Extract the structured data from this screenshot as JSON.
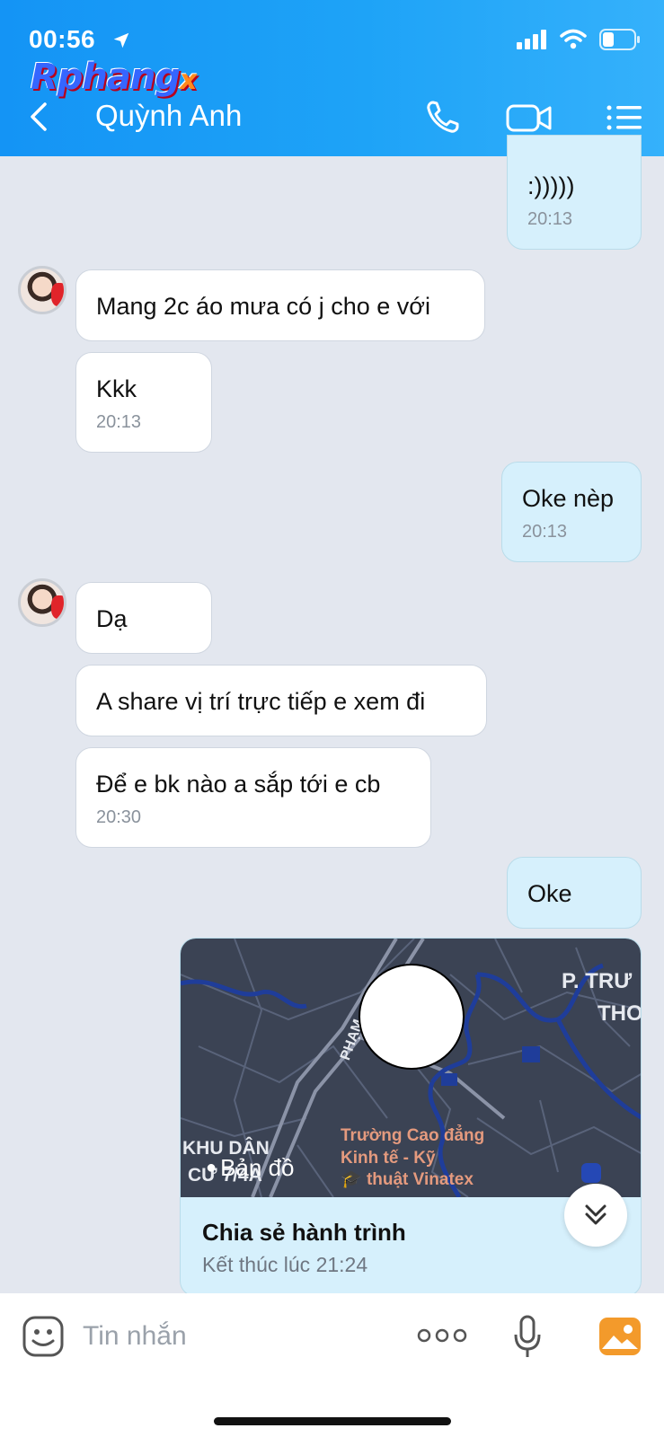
{
  "status_bar": {
    "time": "00:56"
  },
  "watermark": {
    "main": "Rphang",
    "suffix": "x"
  },
  "header": {
    "contact_name": "Quỳnh Anh"
  },
  "messages": [
    {
      "side": "out",
      "text": ":)))))",
      "time": "20:13"
    },
    {
      "side": "in",
      "text": "Mang 2c áo mưa có j cho e với"
    },
    {
      "side": "in",
      "text": "Kkk",
      "time": "20:13"
    },
    {
      "side": "out",
      "text": "Oke nèp",
      "time": "20:13"
    },
    {
      "side": "in",
      "text": "Dạ"
    },
    {
      "side": "in",
      "text": "A share vị trí trực tiếp e xem đi"
    },
    {
      "side": "in",
      "text": "Để e bk nào a sắp tới e cb",
      "time": "20:30"
    },
    {
      "side": "out",
      "text": "Oke"
    }
  ],
  "location_card": {
    "map_labels": {
      "district": "P. TRƯ",
      "district2": "THO",
      "street": "PHẠM",
      "khu": "KHU DÂN",
      "cu": "CƯ 7/4A",
      "poi_line1": "Trường Cao đẳng",
      "poi_line2": "Kinh tế - Kỹ",
      "poi_line3": "thuật Vinatex",
      "maps_brand": "Bản đồ"
    },
    "title": "Chia sẻ hành trình",
    "subtitle": "Kết thúc lúc 21:24"
  },
  "input_bar": {
    "placeholder": "Tin nhắn"
  },
  "colors": {
    "header_start": "#1494f5",
    "header_end": "#35b1fb",
    "outgoing_bubble": "#d6f0fc",
    "incoming_bubble": "#ffffff",
    "background": "#e3e7ef"
  }
}
